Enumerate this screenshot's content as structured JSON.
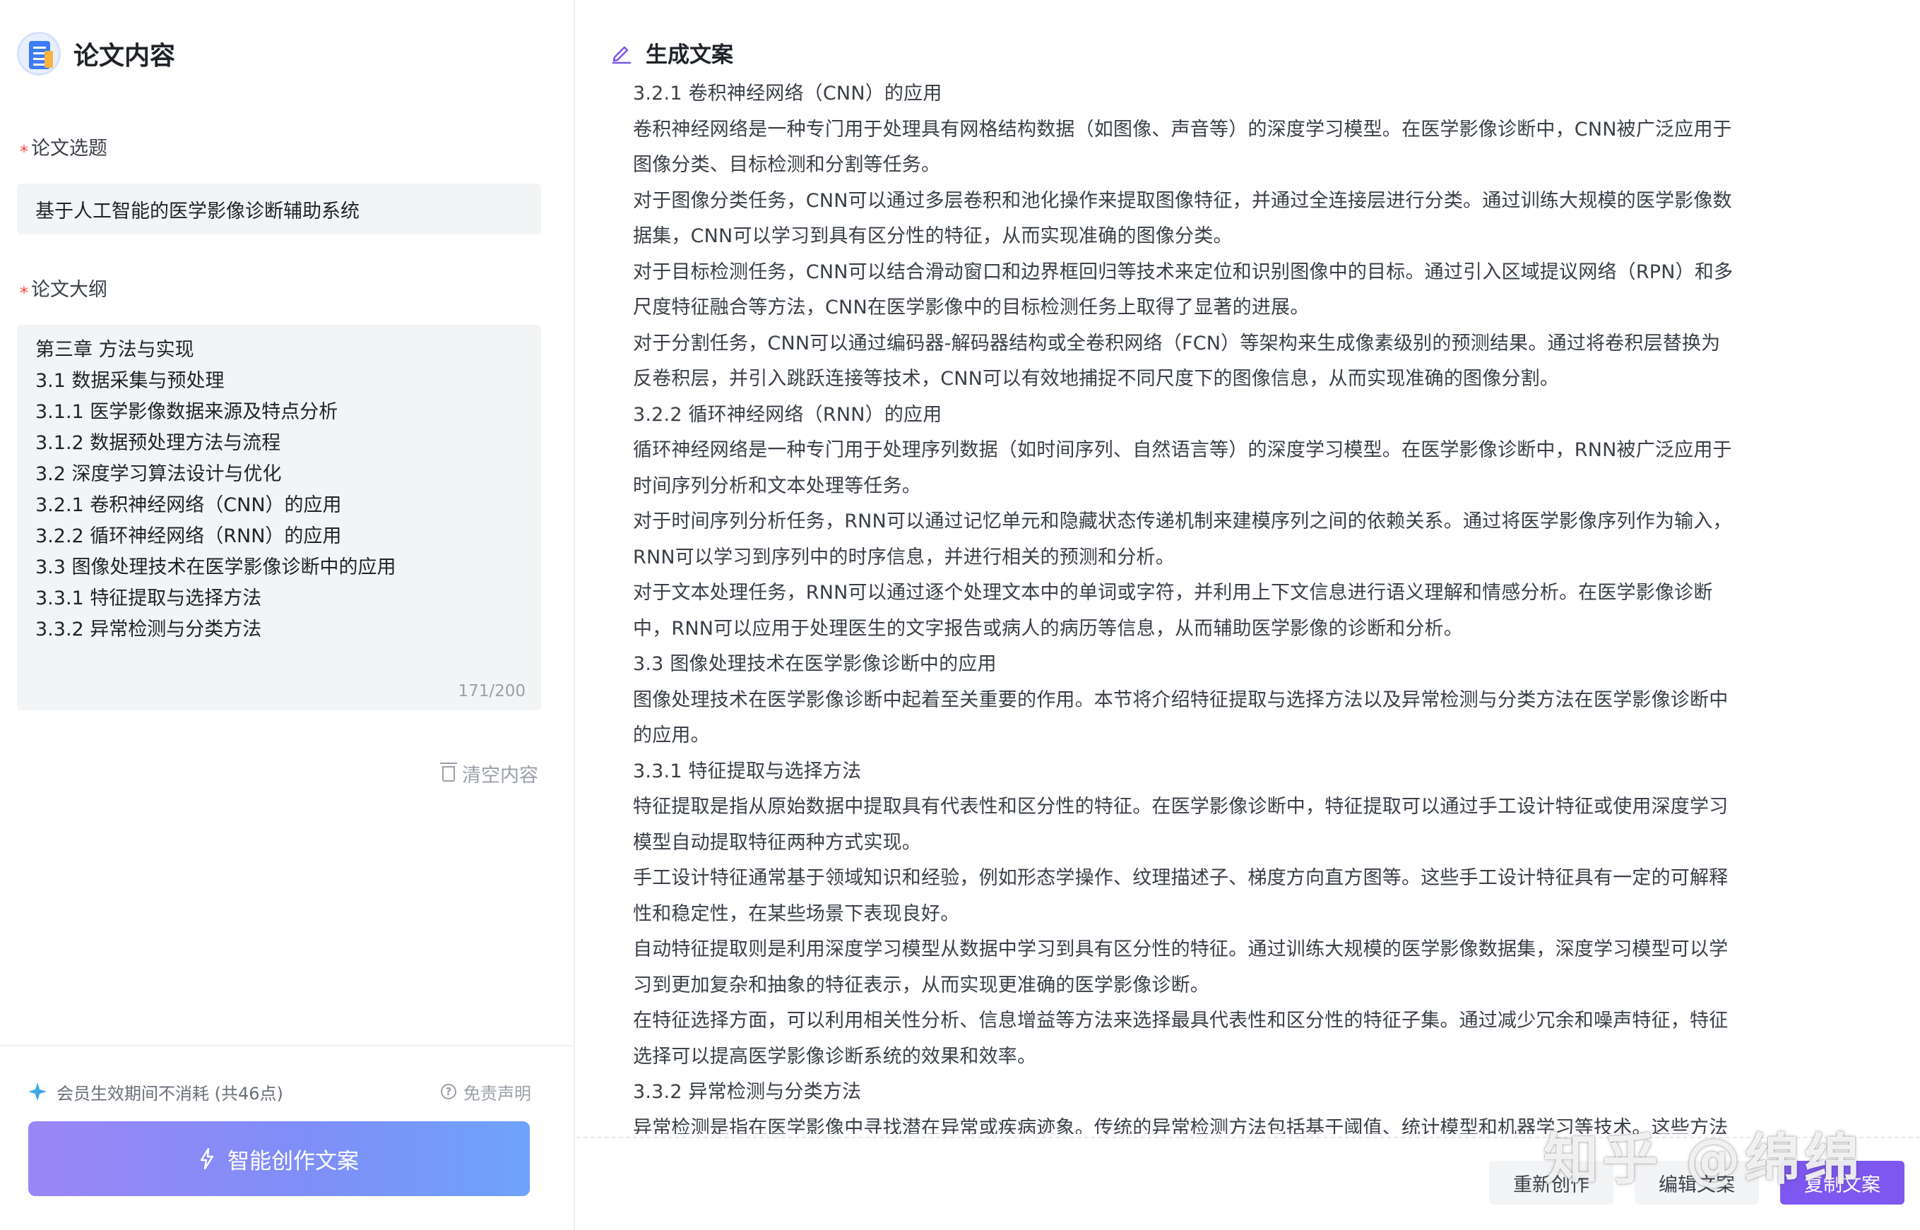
{
  "left_panel": {
    "title": "论文内容",
    "topic_label": "论文选题",
    "topic_value": "基于人工智能的医学影像诊断辅助系统",
    "outline_label": "论文大纲",
    "outline_lines": [
      "第三章 方法与实现",
      "3.1 数据采集与预处理",
      "3.1.1 医学影像数据来源及特点分析",
      "3.1.2 数据预处理方法与流程",
      "3.2 深度学习算法设计与优化",
      "3.2.1 卷积神经网络（CNN）的应用",
      "3.2.2 循环神经网络（RNN）的应用",
      "3.3 图像处理技术在医学影像诊断中的应用",
      "3.3.1 特征提取与选择方法",
      "3.3.2 异常检测与分类方法"
    ],
    "outline_count": "171/200",
    "clear_label": "清空内容",
    "member_note": "会员生效期间不消耗 (共46点)",
    "disclaimer_label": "免责声明",
    "create_button": "智能创作文案",
    "required_mark": "*"
  },
  "right_panel": {
    "title": "生成文案",
    "paragraphs": [
      "3.2.1 卷积神经网络（CNN）的应用",
      "卷积神经网络是一种专门用于处理具有网格结构数据（如图像、声音等）的深度学习模型。在医学影像诊断中，CNN被广泛应用于图像分类、目标检测和分割等任务。",
      "对于图像分类任务，CNN可以通过多层卷积和池化操作来提取图像特征，并通过全连接层进行分类。通过训练大规模的医学影像数据集，CNN可以学习到具有区分性的特征，从而实现准确的图像分类。",
      "对于目标检测任务，CNN可以结合滑动窗口和边界框回归等技术来定位和识别图像中的目标。通过引入区域提议网络（RPN）和多尺度特征融合等方法，CNN在医学影像中的目标检测任务上取得了显著的进展。",
      "对于分割任务，CNN可以通过编码器-解码器结构或全卷积网络（FCN）等架构来生成像素级别的预测结果。通过将卷积层替换为反卷积层，并引入跳跃连接等技术，CNN可以有效地捕捉不同尺度下的图像信息，从而实现准确的图像分割。",
      "3.2.2 循环神经网络（RNN）的应用",
      "循环神经网络是一种专门用于处理序列数据（如时间序列、自然语言等）的深度学习模型。在医学影像诊断中，RNN被广泛应用于时间序列分析和文本处理等任务。",
      "对于时间序列分析任务，RNN可以通过记忆单元和隐藏状态传递机制来建模序列之间的依赖关系。通过将医学影像序列作为输入，RNN可以学习到序列中的时序信息，并进行相关的预测和分析。",
      "对于文本处理任务，RNN可以通过逐个处理文本中的单词或字符，并利用上下文信息进行语义理解和情感分析。在医学影像诊断中，RNN可以应用于处理医生的文字报告或病人的病历等信息，从而辅助医学影像的诊断和分析。",
      "3.3 图像处理技术在医学影像诊断中的应用",
      "图像处理技术在医学影像诊断中起着至关重要的作用。本节将介绍特征提取与选择方法以及异常检测与分类方法在医学影像诊断中的应用。",
      "3.3.1 特征提取与选择方法",
      "特征提取是指从原始数据中提取具有代表性和区分性的特征。在医学影像诊断中，特征提取可以通过手工设计特征或使用深度学习模型自动提取特征两种方式实现。",
      "手工设计特征通常基于领域知识和经验，例如形态学操作、纹理描述子、梯度方向直方图等。这些手工设计特征具有一定的可解释性和稳定性，在某些场景下表现良好。",
      "自动特征提取则是利用深度学习模型从数据中学习到具有区分性的特征。通过训练大规模的医学影像数据集，深度学习模型可以学习到更加复杂和抽象的特征表示，从而实现更准确的医学影像诊断。",
      "在特征选择方面，可以利用相关性分析、信息增益等方法来选择最具代表性和区分性的特征子集。通过减少冗余和噪声特征，特征选择可以提高医学影像诊断系统的效果和效率。",
      "3.3.2 异常检测与分类方法",
      "异常检测是指在医学影像中寻找潜在异常或疾病迹象。传统的异常检测方法包括基于阈值、统计模型和机器学习等技术。这些方法可以"
    ],
    "actions": {
      "regenerate": "重新创作",
      "edit": "编辑文案",
      "copy": "复制文案"
    },
    "watermark": "知乎 @绵绵"
  },
  "colors": {
    "accent_purple": "#7e57f0",
    "gradient_start": "#9b86f6",
    "gradient_end": "#6ea3fb",
    "required_red": "#f5483b"
  }
}
